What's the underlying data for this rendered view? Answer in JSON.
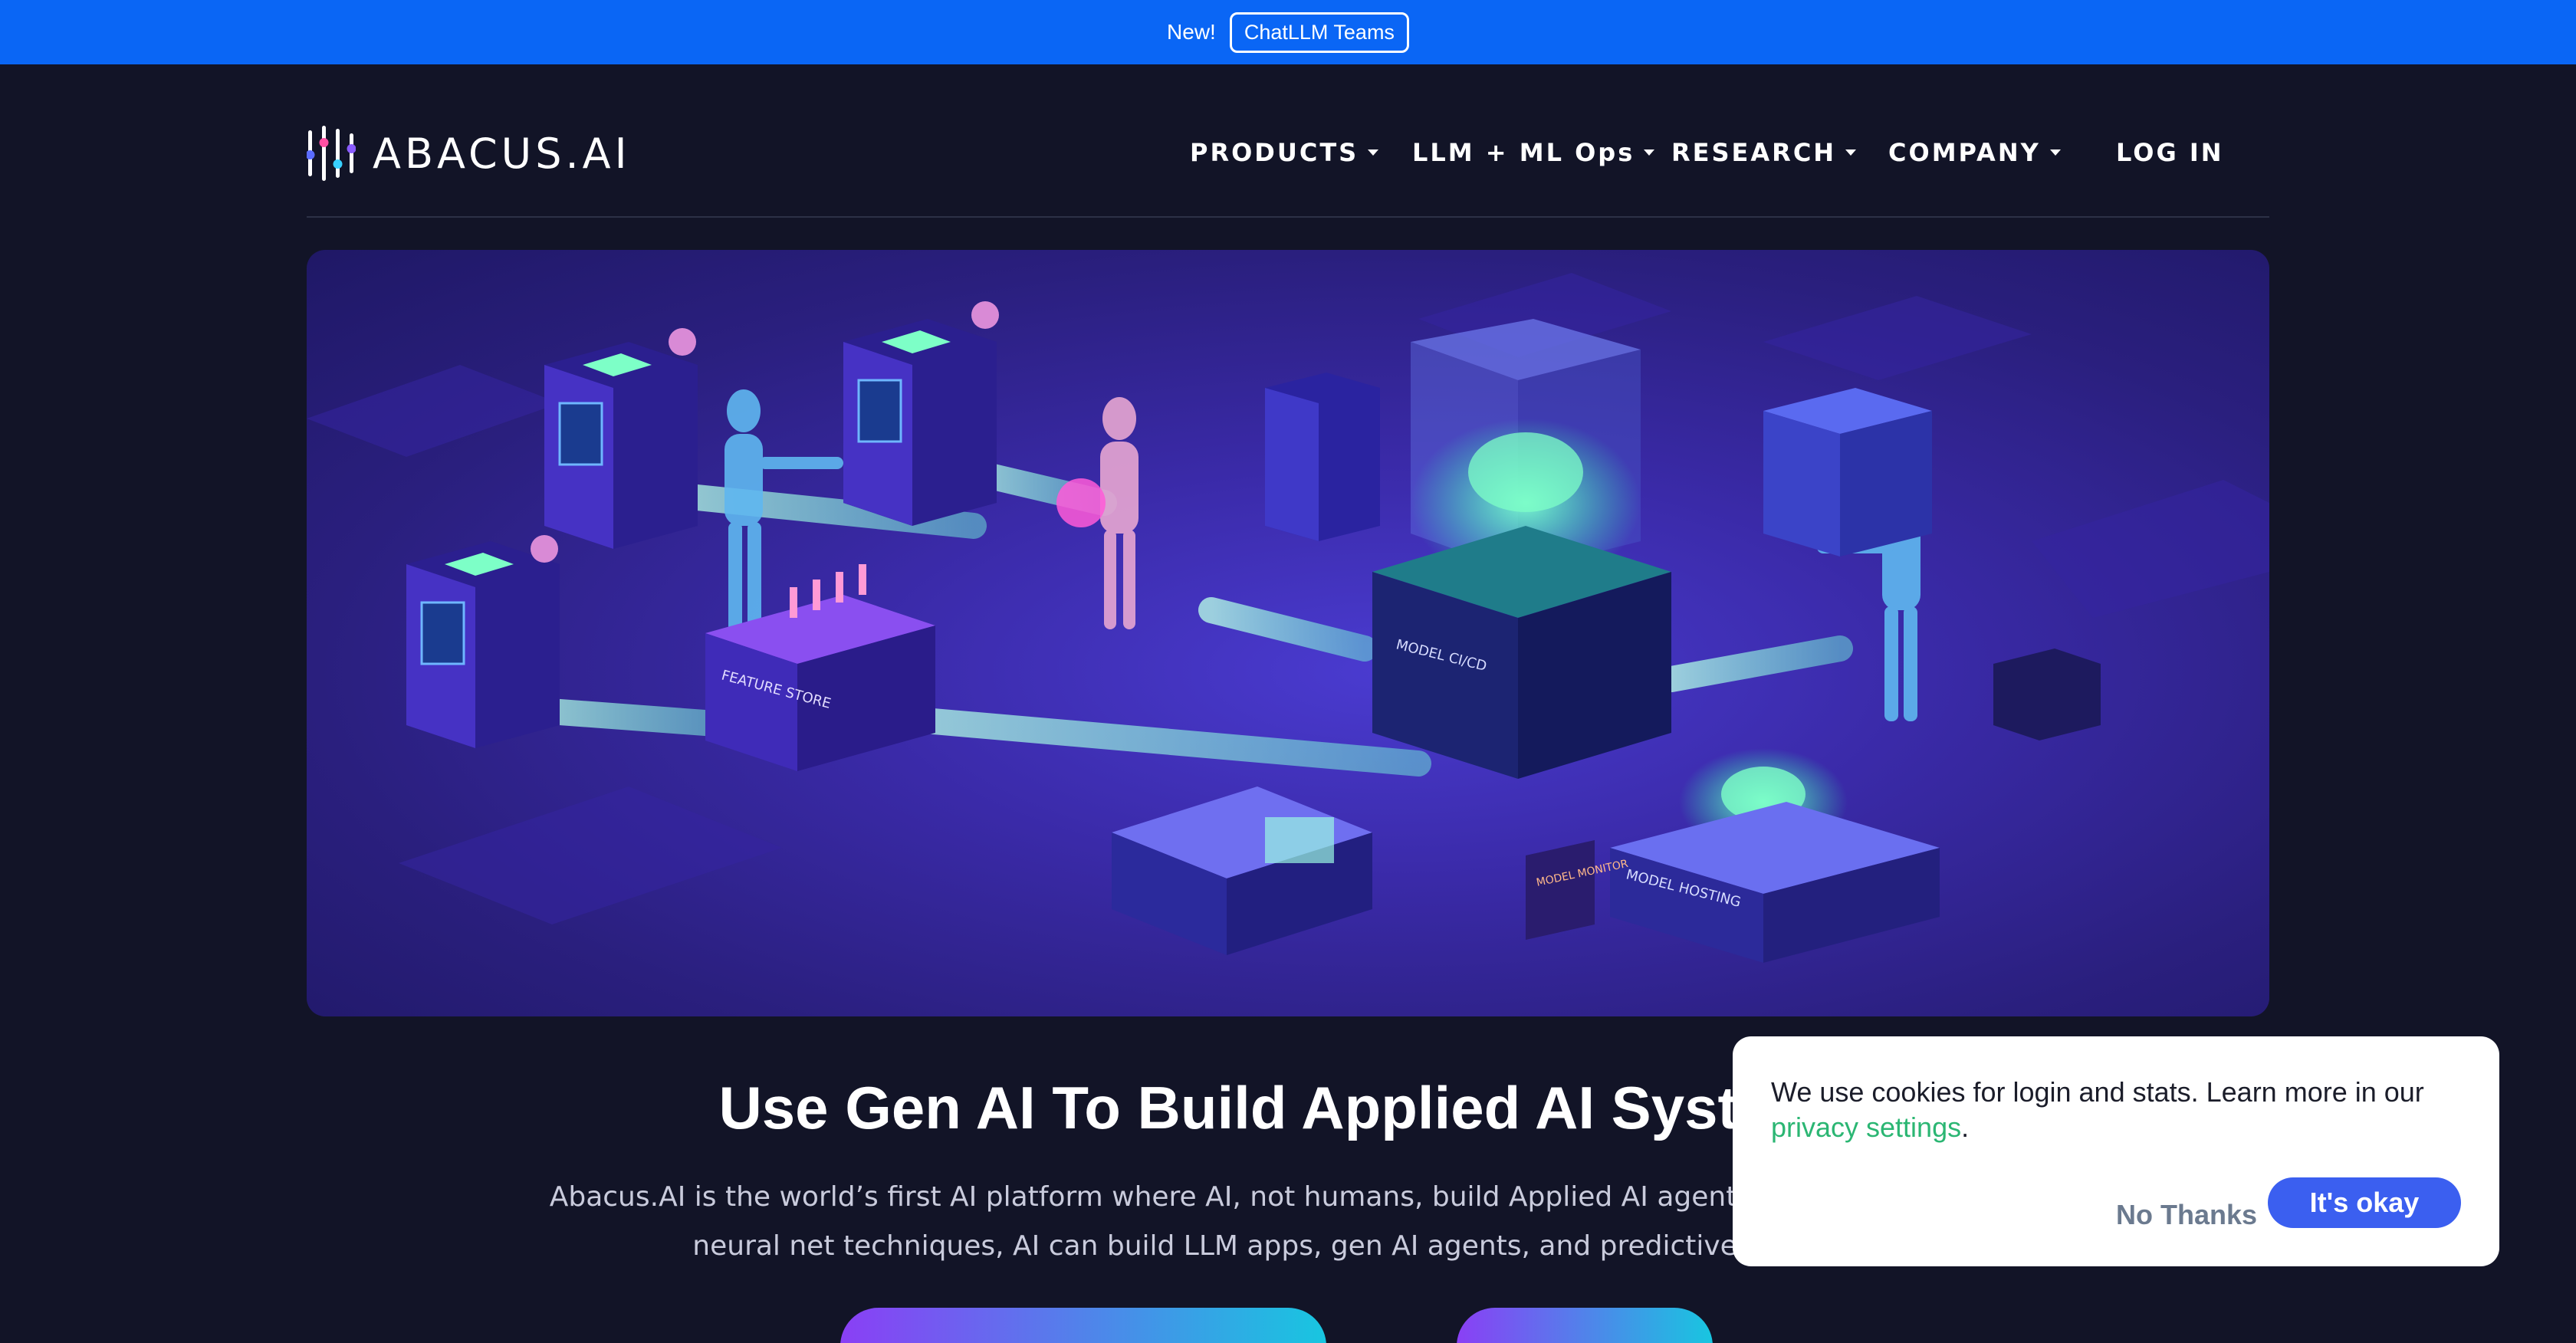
{
  "announcement": {
    "new_label": "New!",
    "link_label": "ChatLLM Teams"
  },
  "brand": {
    "name": "ABACUS.AI"
  },
  "nav": {
    "products": "PRODUCTS",
    "llm_ops": "LLM + ML Ops",
    "research": "RESEARCH",
    "company": "COMPANY",
    "login": "LOG IN"
  },
  "hero": {
    "labels": {
      "feature_store": "FEATURE STORE",
      "model_cicd": "MODEL CI/CD",
      "model_monitor": "MODEL MONITOR",
      "model_hosting": "MODEL HOSTING"
    }
  },
  "main": {
    "headline": "Use Gen AI To Build Applied AI Systems",
    "sub_line1": "Abacus.AI is the world’s first AI platform where AI, not humans, build Applied AI agents and systems at sca",
    "sub_line2": "neural net techniques, AI can build LLM apps, gen AI agents, and predictive applied AI"
  },
  "cookie": {
    "message": "We use cookies for login and stats. Learn more in our ",
    "link": "privacy settings",
    "period": ".",
    "decline": "No Thanks",
    "accept": "It's okay"
  },
  "colors": {
    "announce_bg": "#0a66f5",
    "page_bg": "#121427",
    "accent_green": "#2bb673",
    "accept_blue": "#3b5ff0"
  }
}
